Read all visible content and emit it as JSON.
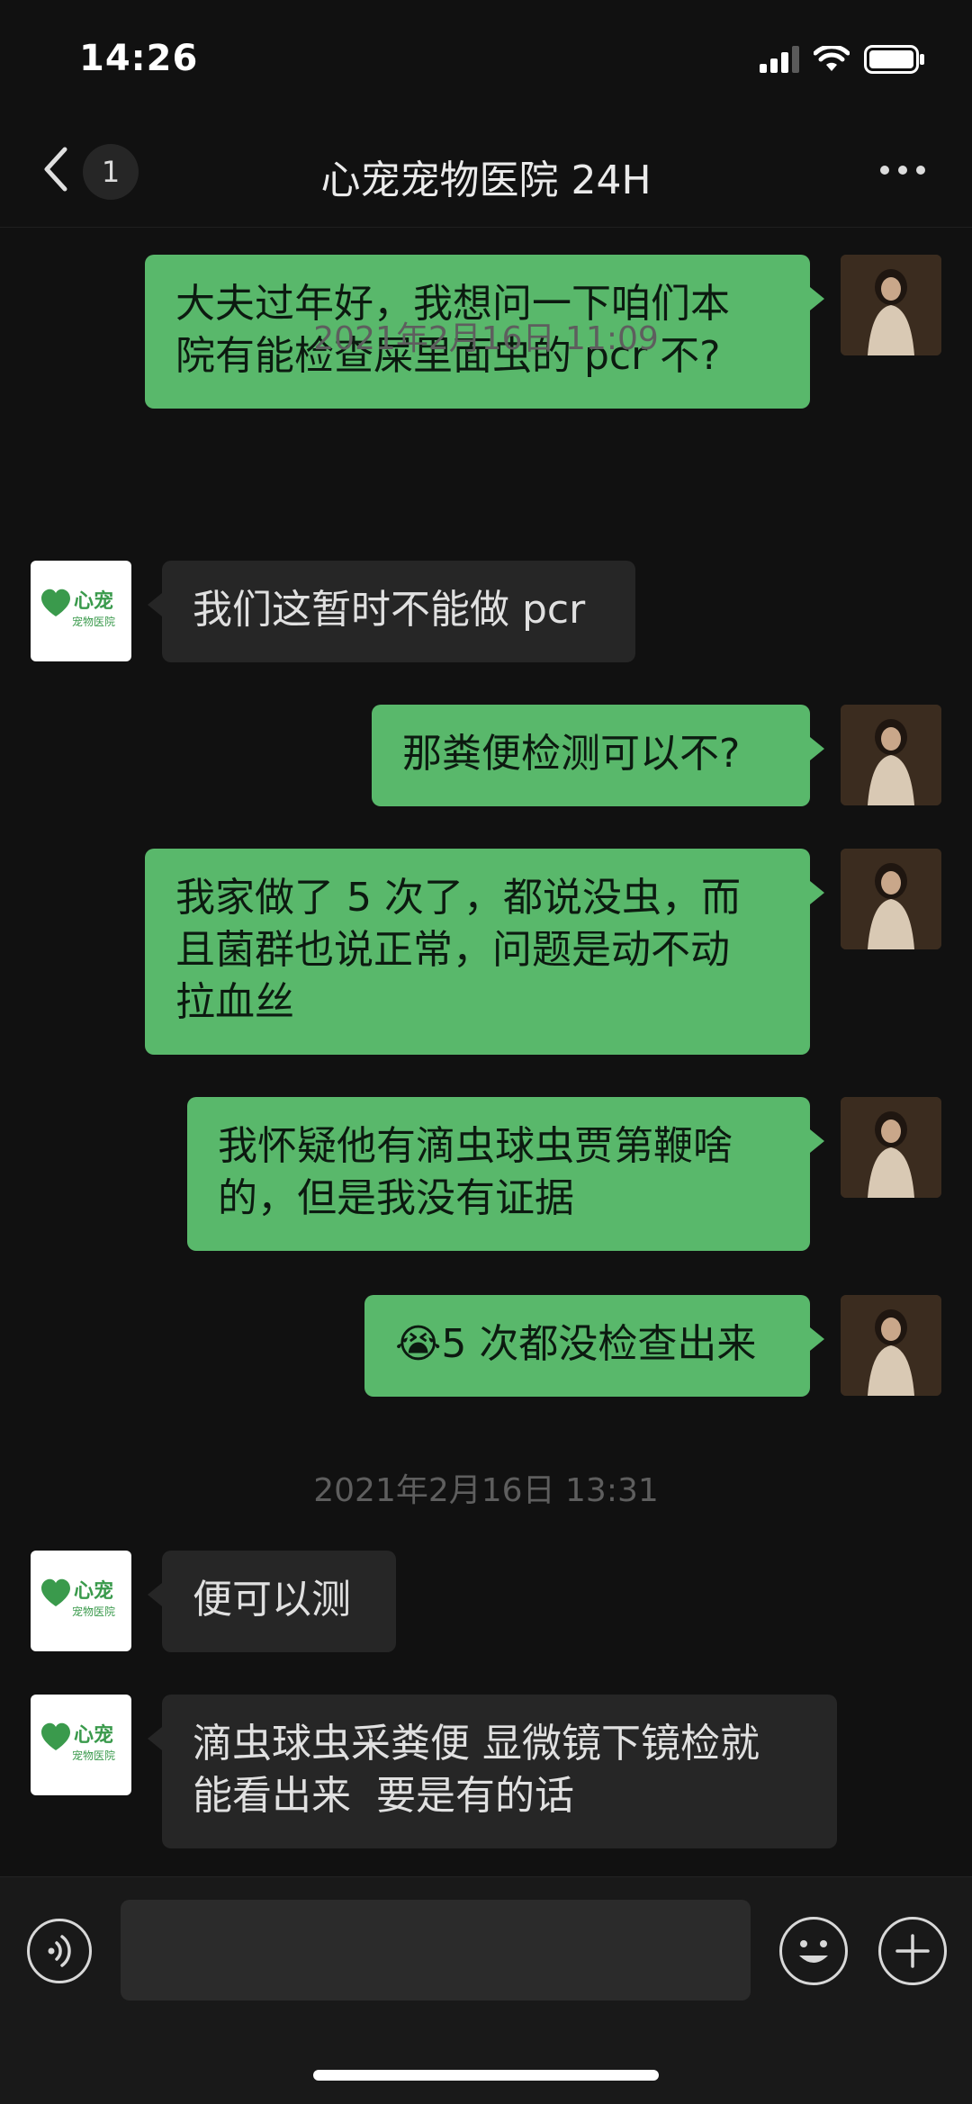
{
  "status": {
    "time": "14:26"
  },
  "header": {
    "title": "心宠宠物医院 24H",
    "unread_count": "1"
  },
  "hospital": {
    "logo_name": "心宠",
    "logo_sub": "宠物医院"
  },
  "messages": [
    {
      "side": "out",
      "text": "大夫过年好，我想问一下咱们本\n院有能检查屎里面虫的 pcr 不?"
    },
    {
      "timestamp": "2021年2月16日 11:09"
    },
    {
      "side": "in",
      "text": "我们这暂时不能做 pcr"
    },
    {
      "side": "out",
      "text": "那粪便检测可以不?"
    },
    {
      "side": "out",
      "text": "我家做了 5 次了，都说没虫，而\n且菌群也说正常，问题是动不动\n拉血丝"
    },
    {
      "side": "out",
      "text": "我怀疑他有滴虫球虫贾第鞭啥\n的，但是我没有证据"
    },
    {
      "side": "out",
      "text": "😭5 次都没检查出来"
    },
    {
      "timestamp": "2021年2月16日 13:31"
    },
    {
      "side": "in",
      "text": "便可以测"
    },
    {
      "side": "in",
      "text": "滴虫球虫采粪便 显微镜下镜检就\n能看出来  要是有的话"
    }
  ],
  "colors": {
    "outgoing_bubble": "#59b86b",
    "incoming_bubble": "#262626",
    "background": "#111111"
  },
  "icons": [
    "back-chevron-icon",
    "more-dots-icon",
    "voice-icon",
    "emoji-icon",
    "plus-icon",
    "signal-icon",
    "wifi-icon",
    "battery-icon"
  ]
}
